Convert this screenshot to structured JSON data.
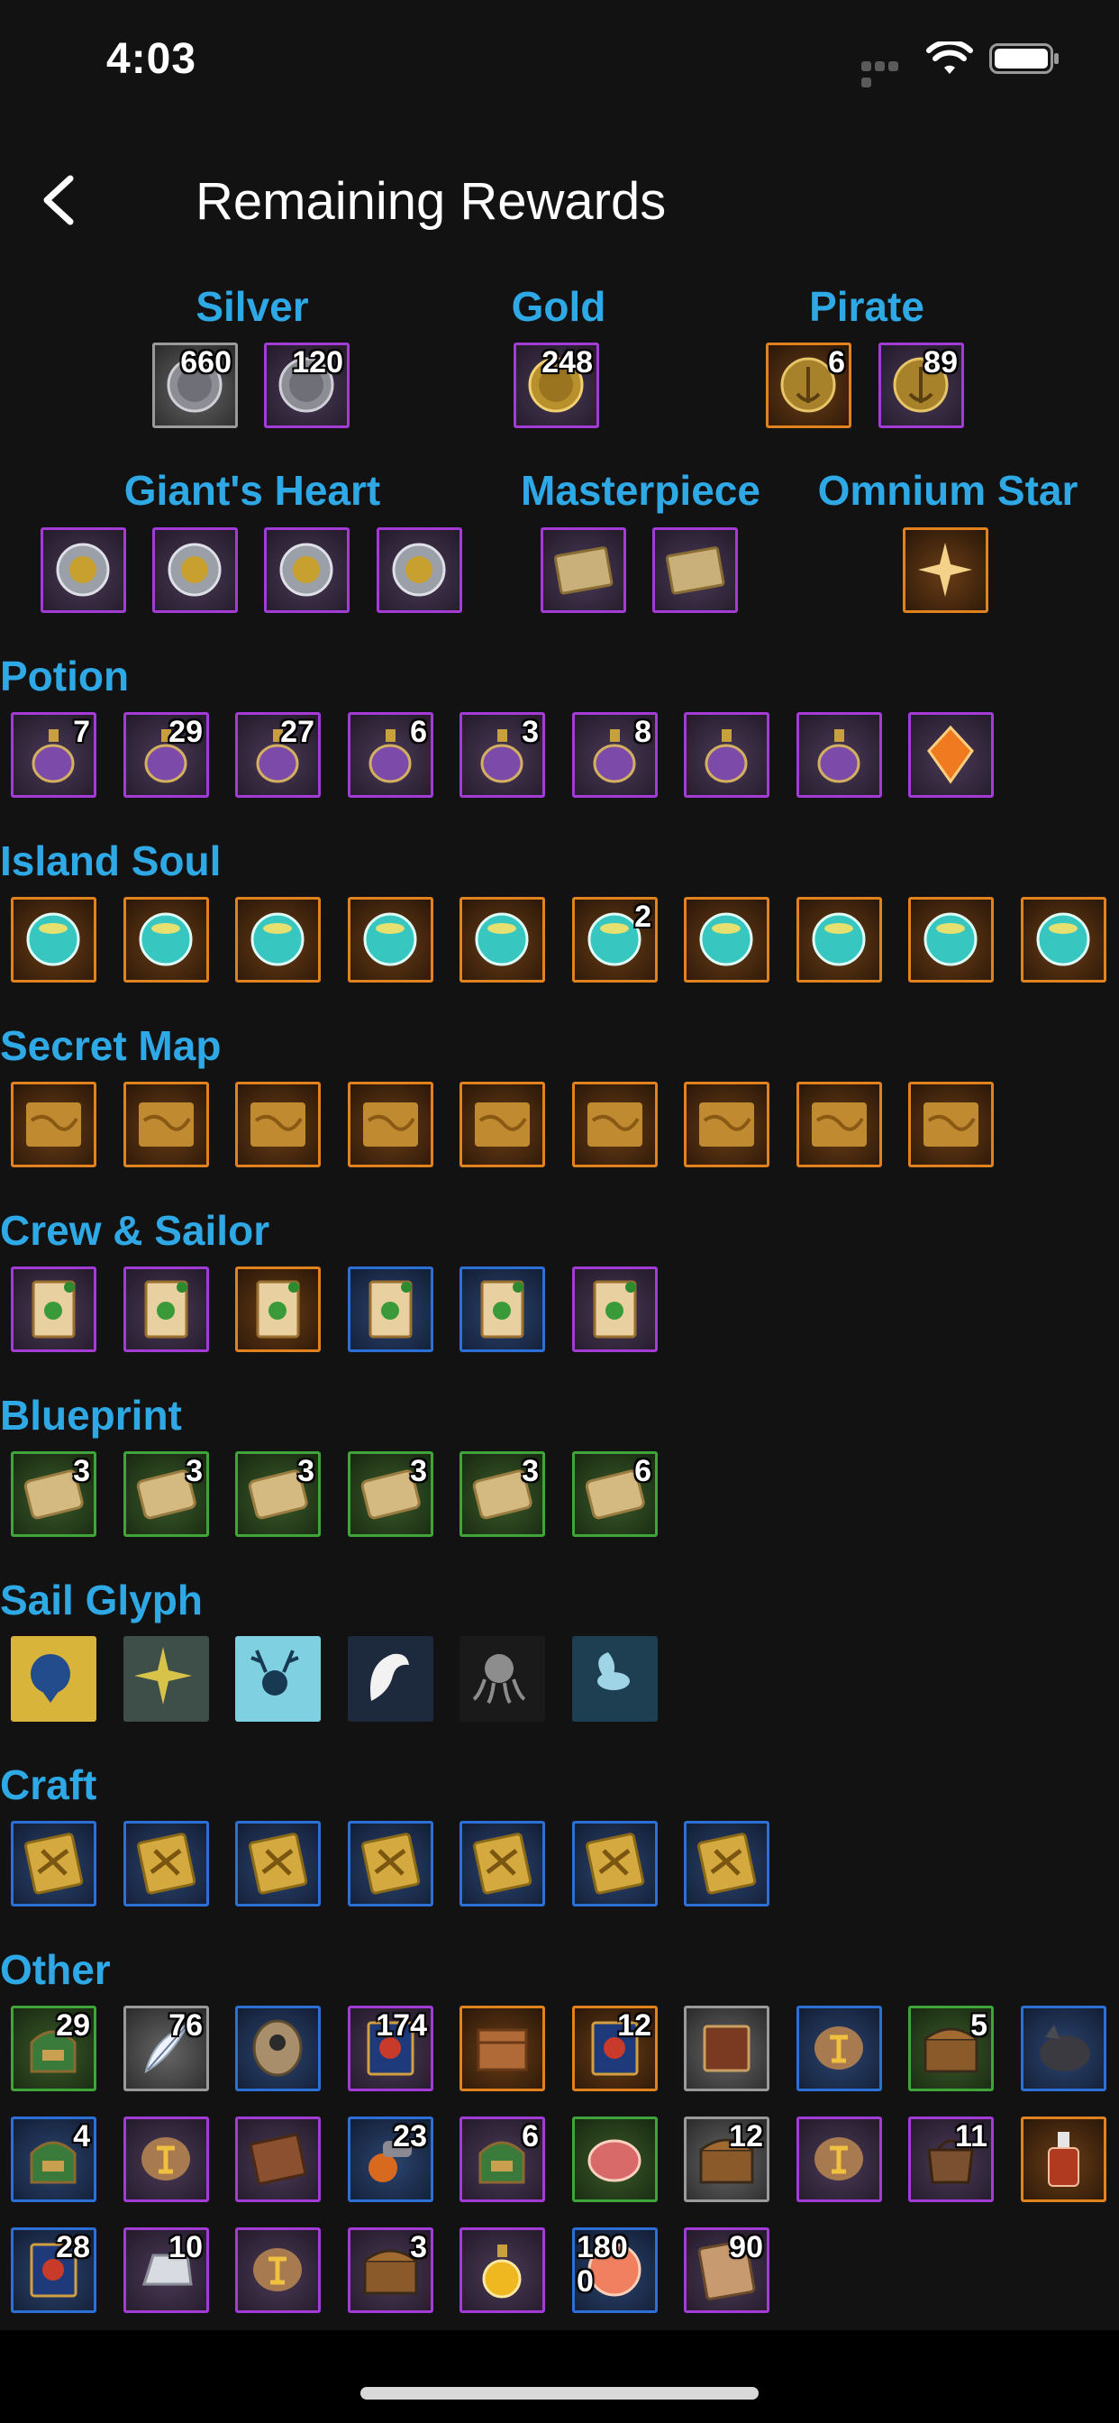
{
  "status_bar": {
    "time": "4:03"
  },
  "header": {
    "title": "Remaining Rewards"
  },
  "top_groups": [
    {
      "label": "Silver",
      "items": [
        {
          "icon": "silver-coin-icon",
          "count": "660",
          "color": "gray"
        },
        {
          "icon": "silver-coin-icon",
          "count": "120",
          "color": "purple"
        }
      ]
    },
    {
      "label": "Gold",
      "items": [
        {
          "icon": "gold-coin-icon",
          "count": "248",
          "color": "purple"
        }
      ]
    },
    {
      "label": "Pirate",
      "items": [
        {
          "icon": "pirate-coin-icon",
          "count": "6",
          "color": "orange"
        },
        {
          "icon": "pirate-coin-icon",
          "count": "89",
          "color": "purple"
        }
      ]
    },
    {
      "label": "Giant's Heart",
      "items": [
        {
          "icon": "giants-heart-icon",
          "count": "",
          "color": "purple"
        },
        {
          "icon": "giants-heart-icon",
          "count": "",
          "color": "purple"
        },
        {
          "icon": "giants-heart-icon",
          "count": "",
          "color": "purple"
        },
        {
          "icon": "giants-heart-icon",
          "count": "",
          "color": "purple"
        }
      ]
    },
    {
      "label": "Masterpiece",
      "items": [
        {
          "icon": "masterpiece-icon",
          "count": "",
          "color": "purple"
        },
        {
          "icon": "masterpiece-icon",
          "count": "",
          "color": "purple"
        }
      ]
    },
    {
      "label": "Omnium Star",
      "items": [
        {
          "icon": "omnium-star-icon",
          "count": "",
          "color": "orange"
        }
      ]
    }
  ],
  "sections": [
    {
      "title": "Potion",
      "items": [
        {
          "icon": "potion-icon",
          "count": "7",
          "color": "purple"
        },
        {
          "icon": "potion-icon",
          "count": "29",
          "color": "purple"
        },
        {
          "icon": "potion-icon",
          "count": "27",
          "color": "purple"
        },
        {
          "icon": "potion-icon",
          "count": "6",
          "color": "purple"
        },
        {
          "icon": "potion-icon",
          "count": "3",
          "color": "purple"
        },
        {
          "icon": "potion-icon",
          "count": "8",
          "color": "purple"
        },
        {
          "icon": "potion-icon",
          "count": "",
          "color": "purple"
        },
        {
          "icon": "potion-icon",
          "count": "",
          "color": "purple"
        },
        {
          "icon": "crystal-icon",
          "count": "",
          "color": "purple"
        }
      ]
    },
    {
      "title": "Island Soul",
      "items": [
        {
          "icon": "island-soul-orb-icon",
          "count": "",
          "color": "orange"
        },
        {
          "icon": "island-soul-orb-icon",
          "count": "",
          "color": "orange"
        },
        {
          "icon": "island-soul-orb-icon",
          "count": "",
          "color": "orange"
        },
        {
          "icon": "island-soul-orb-icon",
          "count": "",
          "color": "orange"
        },
        {
          "icon": "island-soul-orb-icon",
          "count": "",
          "color": "orange"
        },
        {
          "icon": "island-soul-orb-icon",
          "count": "2",
          "color": "orange"
        },
        {
          "icon": "island-soul-orb-icon",
          "count": "",
          "color": "orange"
        },
        {
          "icon": "island-soul-orb-icon",
          "count": "",
          "color": "orange"
        },
        {
          "icon": "island-soul-orb-icon",
          "count": "",
          "color": "orange"
        },
        {
          "icon": "island-soul-orb-icon",
          "count": "",
          "color": "orange"
        }
      ]
    },
    {
      "title": "Secret Map",
      "items": [
        {
          "icon": "secret-map-icon",
          "count": "",
          "color": "orange"
        },
        {
          "icon": "secret-map-icon",
          "count": "",
          "color": "orange"
        },
        {
          "icon": "secret-map-icon",
          "count": "",
          "color": "orange"
        },
        {
          "icon": "secret-map-icon",
          "count": "",
          "color": "orange"
        },
        {
          "icon": "secret-map-icon",
          "count": "",
          "color": "orange"
        },
        {
          "icon": "secret-map-icon",
          "count": "",
          "color": "orange"
        },
        {
          "icon": "secret-map-icon",
          "count": "",
          "color": "orange"
        },
        {
          "icon": "secret-map-icon",
          "count": "",
          "color": "orange"
        },
        {
          "icon": "secret-map-icon",
          "count": "",
          "color": "orange"
        }
      ]
    },
    {
      "title": "Crew & Sailor",
      "items": [
        {
          "icon": "crew-contract-icon",
          "count": "",
          "color": "purple"
        },
        {
          "icon": "crew-contract-icon",
          "count": "",
          "color": "purple"
        },
        {
          "icon": "crew-contract-icon",
          "count": "",
          "color": "orange"
        },
        {
          "icon": "crew-contract-icon",
          "count": "",
          "color": "blue"
        },
        {
          "icon": "crew-contract-icon",
          "count": "",
          "color": "blue"
        },
        {
          "icon": "crew-contract-icon",
          "count": "",
          "color": "purple"
        }
      ]
    },
    {
      "title": "Blueprint",
      "items": [
        {
          "icon": "blueprint-scroll-icon",
          "count": "3",
          "color": "green"
        },
        {
          "icon": "blueprint-scroll-icon",
          "count": "3",
          "color": "green"
        },
        {
          "icon": "blueprint-scroll-icon",
          "count": "3",
          "color": "green"
        },
        {
          "icon": "blueprint-scroll-icon",
          "count": "3",
          "color": "green"
        },
        {
          "icon": "blueprint-scroll-icon",
          "count": "3",
          "color": "green"
        },
        {
          "icon": "blueprint-scroll-icon",
          "count": "6",
          "color": "green"
        }
      ]
    },
    {
      "title": "Sail Glyph",
      "items": [
        {
          "icon": "lion-glyph-icon",
          "count": "",
          "color": "none",
          "bg": "#d8b43a",
          "fg": "#234c8c"
        },
        {
          "icon": "compass-star-glyph-icon",
          "count": "",
          "color": "none",
          "bg": "#3d4f48",
          "fg": "#d7c24a"
        },
        {
          "icon": "stag-glyph-icon",
          "count": "",
          "color": "none",
          "bg": "#7fd0e0",
          "fg": "#173a52"
        },
        {
          "icon": "eagle-glyph-icon",
          "count": "",
          "color": "none",
          "bg": "#1d2a3e",
          "fg": "#f2f2f2"
        },
        {
          "icon": "kraken-glyph-icon",
          "count": "",
          "color": "none",
          "bg": "#1a1a1a",
          "fg": "#8d8d8d"
        },
        {
          "icon": "pegasus-glyph-icon",
          "count": "",
          "color": "none",
          "bg": "#1e3e52",
          "fg": "#9fd3e6"
        }
      ]
    },
    {
      "title": "Craft",
      "items": [
        {
          "icon": "craft-tablet-icon",
          "count": "",
          "color": "blue"
        },
        {
          "icon": "craft-tablet-icon",
          "count": "",
          "color": "blue"
        },
        {
          "icon": "craft-tablet-icon",
          "count": "",
          "color": "blue"
        },
        {
          "icon": "craft-tablet-icon",
          "count": "",
          "color": "blue"
        },
        {
          "icon": "craft-tablet-icon",
          "count": "",
          "color": "blue"
        },
        {
          "icon": "craft-tablet-icon",
          "count": "",
          "color": "blue"
        },
        {
          "icon": "craft-tablet-icon",
          "count": "",
          "color": "blue"
        }
      ]
    },
    {
      "title": "Other",
      "items": [
        {
          "icon": "supply-bag-icon",
          "count": "29",
          "color": "green"
        },
        {
          "icon": "feather-icon",
          "count": "76",
          "color": "gray"
        },
        {
          "icon": "portrait-coin-icon",
          "count": "",
          "color": "blue"
        },
        {
          "icon": "spellbook-icon",
          "count": "174",
          "color": "purple"
        },
        {
          "icon": "crate-icon",
          "count": "",
          "color": "orange"
        },
        {
          "icon": "spellbook-icon",
          "count": "12",
          "color": "orange"
        },
        {
          "icon": "tome-icon",
          "count": "",
          "color": "gray"
        },
        {
          "icon": "rune-stone-icon",
          "count": "",
          "color": "blue"
        },
        {
          "icon": "treasure-chest-icon",
          "count": "5",
          "color": "green"
        },
        {
          "icon": "wolf-icon",
          "count": "",
          "color": "blue"
        },
        {
          "icon": "supply-bag-icon",
          "count": "4",
          "color": "blue"
        },
        {
          "icon": "rune-stone-icon",
          "count": "",
          "color": "purple"
        },
        {
          "icon": "leather-book-icon",
          "count": "",
          "color": "purple"
        },
        {
          "icon": "cannon-icon",
          "count": "23",
          "color": "blue"
        },
        {
          "icon": "supply-bag-icon",
          "count": "6",
          "color": "purple"
        },
        {
          "icon": "meat-icon",
          "count": "",
          "color": "green"
        },
        {
          "icon": "treasure-chest-icon",
          "count": "12",
          "color": "gray"
        },
        {
          "icon": "rune-stone-icon",
          "count": "",
          "color": "purple"
        },
        {
          "icon": "satchel-icon",
          "count": "11",
          "color": "purple"
        },
        {
          "icon": "liquor-bottle-icon",
          "count": "",
          "color": "orange"
        },
        {
          "icon": "spellbook-icon",
          "count": "28",
          "color": "blue"
        },
        {
          "icon": "silver-ingot-icon",
          "count": "10",
          "color": "purple"
        },
        {
          "icon": "rune-stone-icon",
          "count": "",
          "color": "purple"
        },
        {
          "icon": "treasure-chest-icon",
          "count": "3",
          "color": "purple"
        },
        {
          "icon": "elixir-flask-icon",
          "count": "",
          "color": "purple"
        },
        {
          "icon": "orb-icon",
          "count": "180\n0",
          "color": "blue"
        },
        {
          "icon": "engraved-tablet-icon",
          "count": "90",
          "color": "purple"
        }
      ]
    }
  ]
}
